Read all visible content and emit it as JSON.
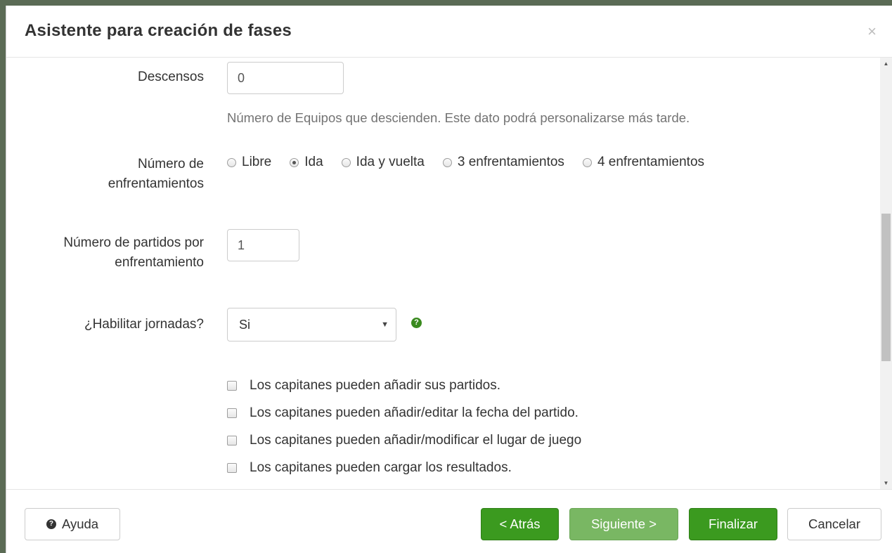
{
  "dialog": {
    "title": "Asistente para creación de fases",
    "close_label": "×"
  },
  "form": {
    "descensos": {
      "label": "Descensos",
      "value": "0",
      "help": "Número de Equipos que descienden. Este dato podrá personalizarse más tarde."
    },
    "enfrentamientos": {
      "label_line1": "Número de",
      "label_line2": "enfrentamientos",
      "options": [
        "Libre",
        "Ida",
        "Ida y vuelta",
        "3 enfrentamientos",
        "4 enfrentamientos"
      ],
      "selected": "Ida"
    },
    "partidos": {
      "label_line1": "Número de partidos por",
      "label_line2": "enfrentamiento",
      "value": "1"
    },
    "jornadas": {
      "label": "¿Habilitar jornadas?",
      "selected": "Si",
      "help_icon": "question-circle-icon"
    },
    "checkboxes": [
      "Los capitanes pueden añadir sus partidos.",
      "Los capitanes pueden añadir/editar la fecha del partido.",
      "Los capitanes pueden añadir/modificar el lugar de juego",
      "Los capitanes pueden cargar los resultados."
    ]
  },
  "footer": {
    "help_label": "Ayuda",
    "back_label": "< Atrás",
    "next_label": "Siguiente >",
    "finish_label": "Finalizar",
    "cancel_label": "Cancelar"
  },
  "colors": {
    "green": "#3b9a1f",
    "green_disabled": "#79b763"
  }
}
